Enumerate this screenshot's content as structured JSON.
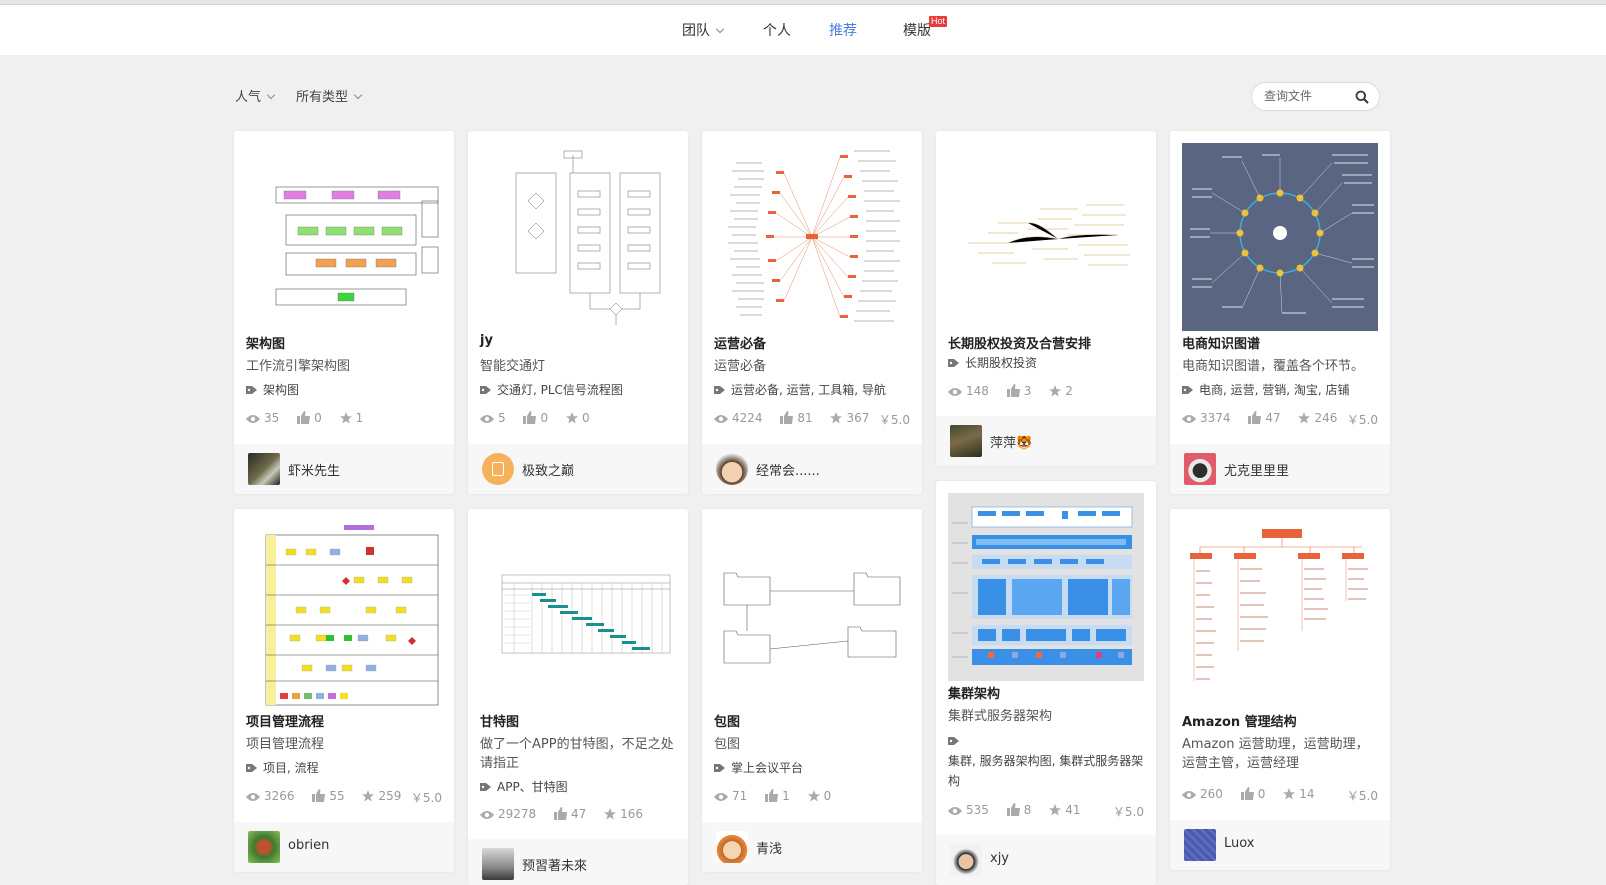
{
  "nav": {
    "team": "团队",
    "personal": "个人",
    "recommend": "推荐",
    "templates": "模版",
    "hot_badge": "Hot",
    "active_color": "#4a7de2"
  },
  "filters": {
    "sort": "人气",
    "type": "所有类型"
  },
  "search": {
    "placeholder": "查询文件"
  },
  "cards": [
    {
      "title": "架构图",
      "desc": "工作流引擎架构图",
      "tags": "架构图",
      "views": "35",
      "likes": "0",
      "stars": "1",
      "price": "",
      "author": "虾米先生"
    },
    {
      "title": "jy",
      "desc": "智能交通灯",
      "tags": "交通灯, PLC信号流程图",
      "views": "5",
      "likes": "0",
      "stars": "0",
      "price": "",
      "author": "极致之巅"
    },
    {
      "title": "运营必备",
      "desc": "运营必备",
      "tags": "运营必备, 运营, 工具箱, 导航",
      "views": "4224",
      "likes": "81",
      "stars": "367",
      "price": "￥5.0",
      "author": "经常会......"
    },
    {
      "title": "长期股权投资及合营安排",
      "desc": "",
      "tags": "长期股权投资",
      "views": "148",
      "likes": "3",
      "stars": "2",
      "price": "",
      "author": "萍萍🐯"
    },
    {
      "title": "电商知识图谱",
      "desc": "电商知识图谱，覆盖各个环节。",
      "tags": "电商, 运营, 营销, 淘宝, 店铺",
      "views": "3374",
      "likes": "47",
      "stars": "246",
      "price": "￥5.0",
      "author": "尤克里里里"
    },
    {
      "title": "项目管理流程",
      "desc": "项目管理流程",
      "tags": "项目, 流程",
      "views": "3266",
      "likes": "55",
      "stars": "259",
      "price": "￥5.0",
      "author": "obrien"
    },
    {
      "title": "甘特图",
      "desc": "做了一个APP的甘特图，不足之处请指正",
      "tags": "APP、甘特图",
      "views": "29278",
      "likes": "47",
      "stars": "166",
      "price": "",
      "author": "预習著未來"
    },
    {
      "title": "包图",
      "desc": "包图",
      "tags": "掌上会议平台",
      "views": "71",
      "likes": "1",
      "stars": "0",
      "price": "",
      "author": "青浅"
    },
    {
      "title": "集群架构",
      "desc": "集群式服务器架构",
      "tags": "集群, 服务器架构图, 集群式服务器架构",
      "views": "535",
      "likes": "8",
      "stars": "41",
      "price": "￥5.0",
      "author": "xjy"
    },
    {
      "title": "Amazon 管理结构",
      "desc": "Amazon 运营助理，运营助理，运营主管，运营经理",
      "tags": "",
      "views": "260",
      "likes": "0",
      "stars": "14",
      "price": "￥5.0",
      "author": "Luox"
    }
  ]
}
